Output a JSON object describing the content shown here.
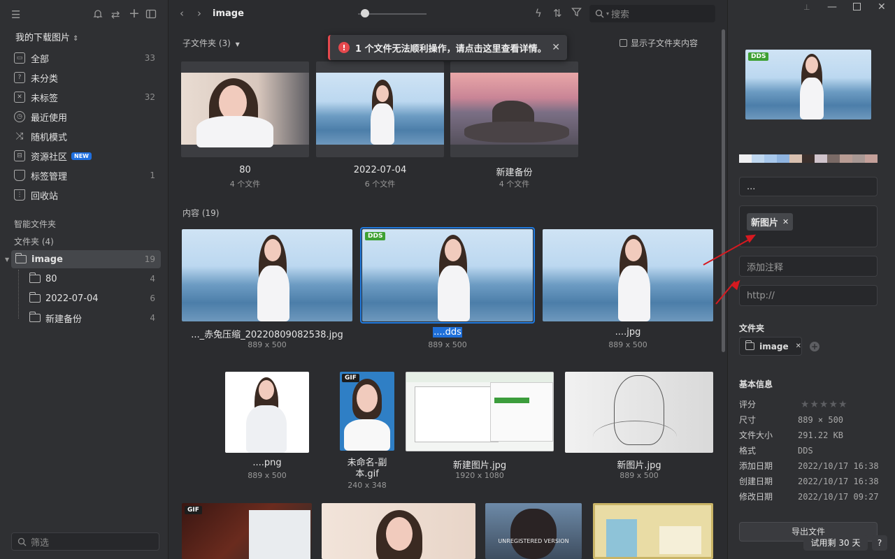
{
  "sidebar": {
    "library_name": "我的下载图片",
    "items": [
      {
        "label": "全部",
        "count": "33",
        "icon": "inbox-icon"
      },
      {
        "label": "未分类",
        "count": "",
        "icon": "unsorted-icon"
      },
      {
        "label": "未标签",
        "count": "32",
        "icon": "untagged-icon"
      },
      {
        "label": "最近使用",
        "count": "",
        "icon": "clock-icon"
      },
      {
        "label": "随机模式",
        "count": "",
        "icon": "shuffle-icon"
      },
      {
        "label": "资源社区",
        "count": "",
        "icon": "community-icon",
        "badge": "NEW"
      },
      {
        "label": "标签管理",
        "count": "1",
        "icon": "tag-icon"
      },
      {
        "label": "回收站",
        "count": "",
        "icon": "trash-icon"
      }
    ],
    "smart_folders_label": "智能文件夹",
    "folders_label": "文件夹 (4)",
    "folders": [
      {
        "label": "image",
        "count": "19"
      },
      {
        "label": "80",
        "count": "4"
      },
      {
        "label": "2022-07-04",
        "count": "6"
      },
      {
        "label": "新建备份",
        "count": "4"
      }
    ],
    "filter_placeholder": "筛选"
  },
  "toolbar": {
    "folder_title": "image",
    "search_placeholder": "搜索",
    "zoom_level": 0.1
  },
  "content": {
    "subfolders_label": "子文件夹 (3)",
    "show_sub_content": "显示子文件夹内容",
    "error_message": "1 个文件无法顺利操作，请点击这里查看详情。",
    "subfolders": [
      {
        "name": "80",
        "count": "4 个文件"
      },
      {
        "name": "2022-07-04",
        "count": "6 个文件"
      },
      {
        "name": "新建备份",
        "count": "4 个文件"
      }
    ],
    "content_label": "内容 (19)",
    "row1": [
      {
        "name": "..._赤兔压缩_20220809082538.jpg",
        "size": "889 x 500"
      },
      {
        "name": "....dds",
        "size": "889 x 500",
        "badge": "DDS"
      },
      {
        "name": "....jpg",
        "size": "889 x 500"
      }
    ],
    "row2": [
      {
        "name": "....png",
        "size": "889 x 500"
      },
      {
        "name": "未命名-副本.gif",
        "size": "240 x 348",
        "badge": "GIF"
      },
      {
        "name": "新建图片.jpg",
        "size": "1920 x 1080"
      },
      {
        "name": "新图片.jpg",
        "size": "889 x 500"
      }
    ],
    "row3_badges": [
      "GIF"
    ],
    "watermark_text": "UNREGISTERED VERSION"
  },
  "panel": {
    "preview_badge": "DDS",
    "palette": [
      "#f0f0f2",
      "#c0d8f0",
      "#a8c8ec",
      "#8fb4e0",
      "#d8c0b0",
      "#3a2f2c",
      "#d0c4cc",
      "#7a6a66",
      "#b89c94",
      "#a89894",
      "#c4a09a"
    ],
    "name_value": "...",
    "tags": [
      "新图片"
    ],
    "note_placeholder": "添加注释",
    "url_placeholder": "http://",
    "folder_section": "文件夹",
    "folder_chip": "image",
    "basic_info": "基本信息",
    "rating_label": "评分",
    "rating": 0,
    "rows": [
      {
        "k": "尺寸",
        "v": "889 × 500"
      },
      {
        "k": "文件大小",
        "v": "291.22 KB"
      },
      {
        "k": "格式",
        "v": "DDS"
      },
      {
        "k": "添加日期",
        "v": "2022/10/17 16:38"
      },
      {
        "k": "创建日期",
        "v": "2022/10/17 16:38"
      },
      {
        "k": "修改日期",
        "v": "2022/10/17 09:27"
      }
    ],
    "export_label": "导出文件",
    "trial_label": "试用剩 30 天",
    "help_label": "?"
  }
}
